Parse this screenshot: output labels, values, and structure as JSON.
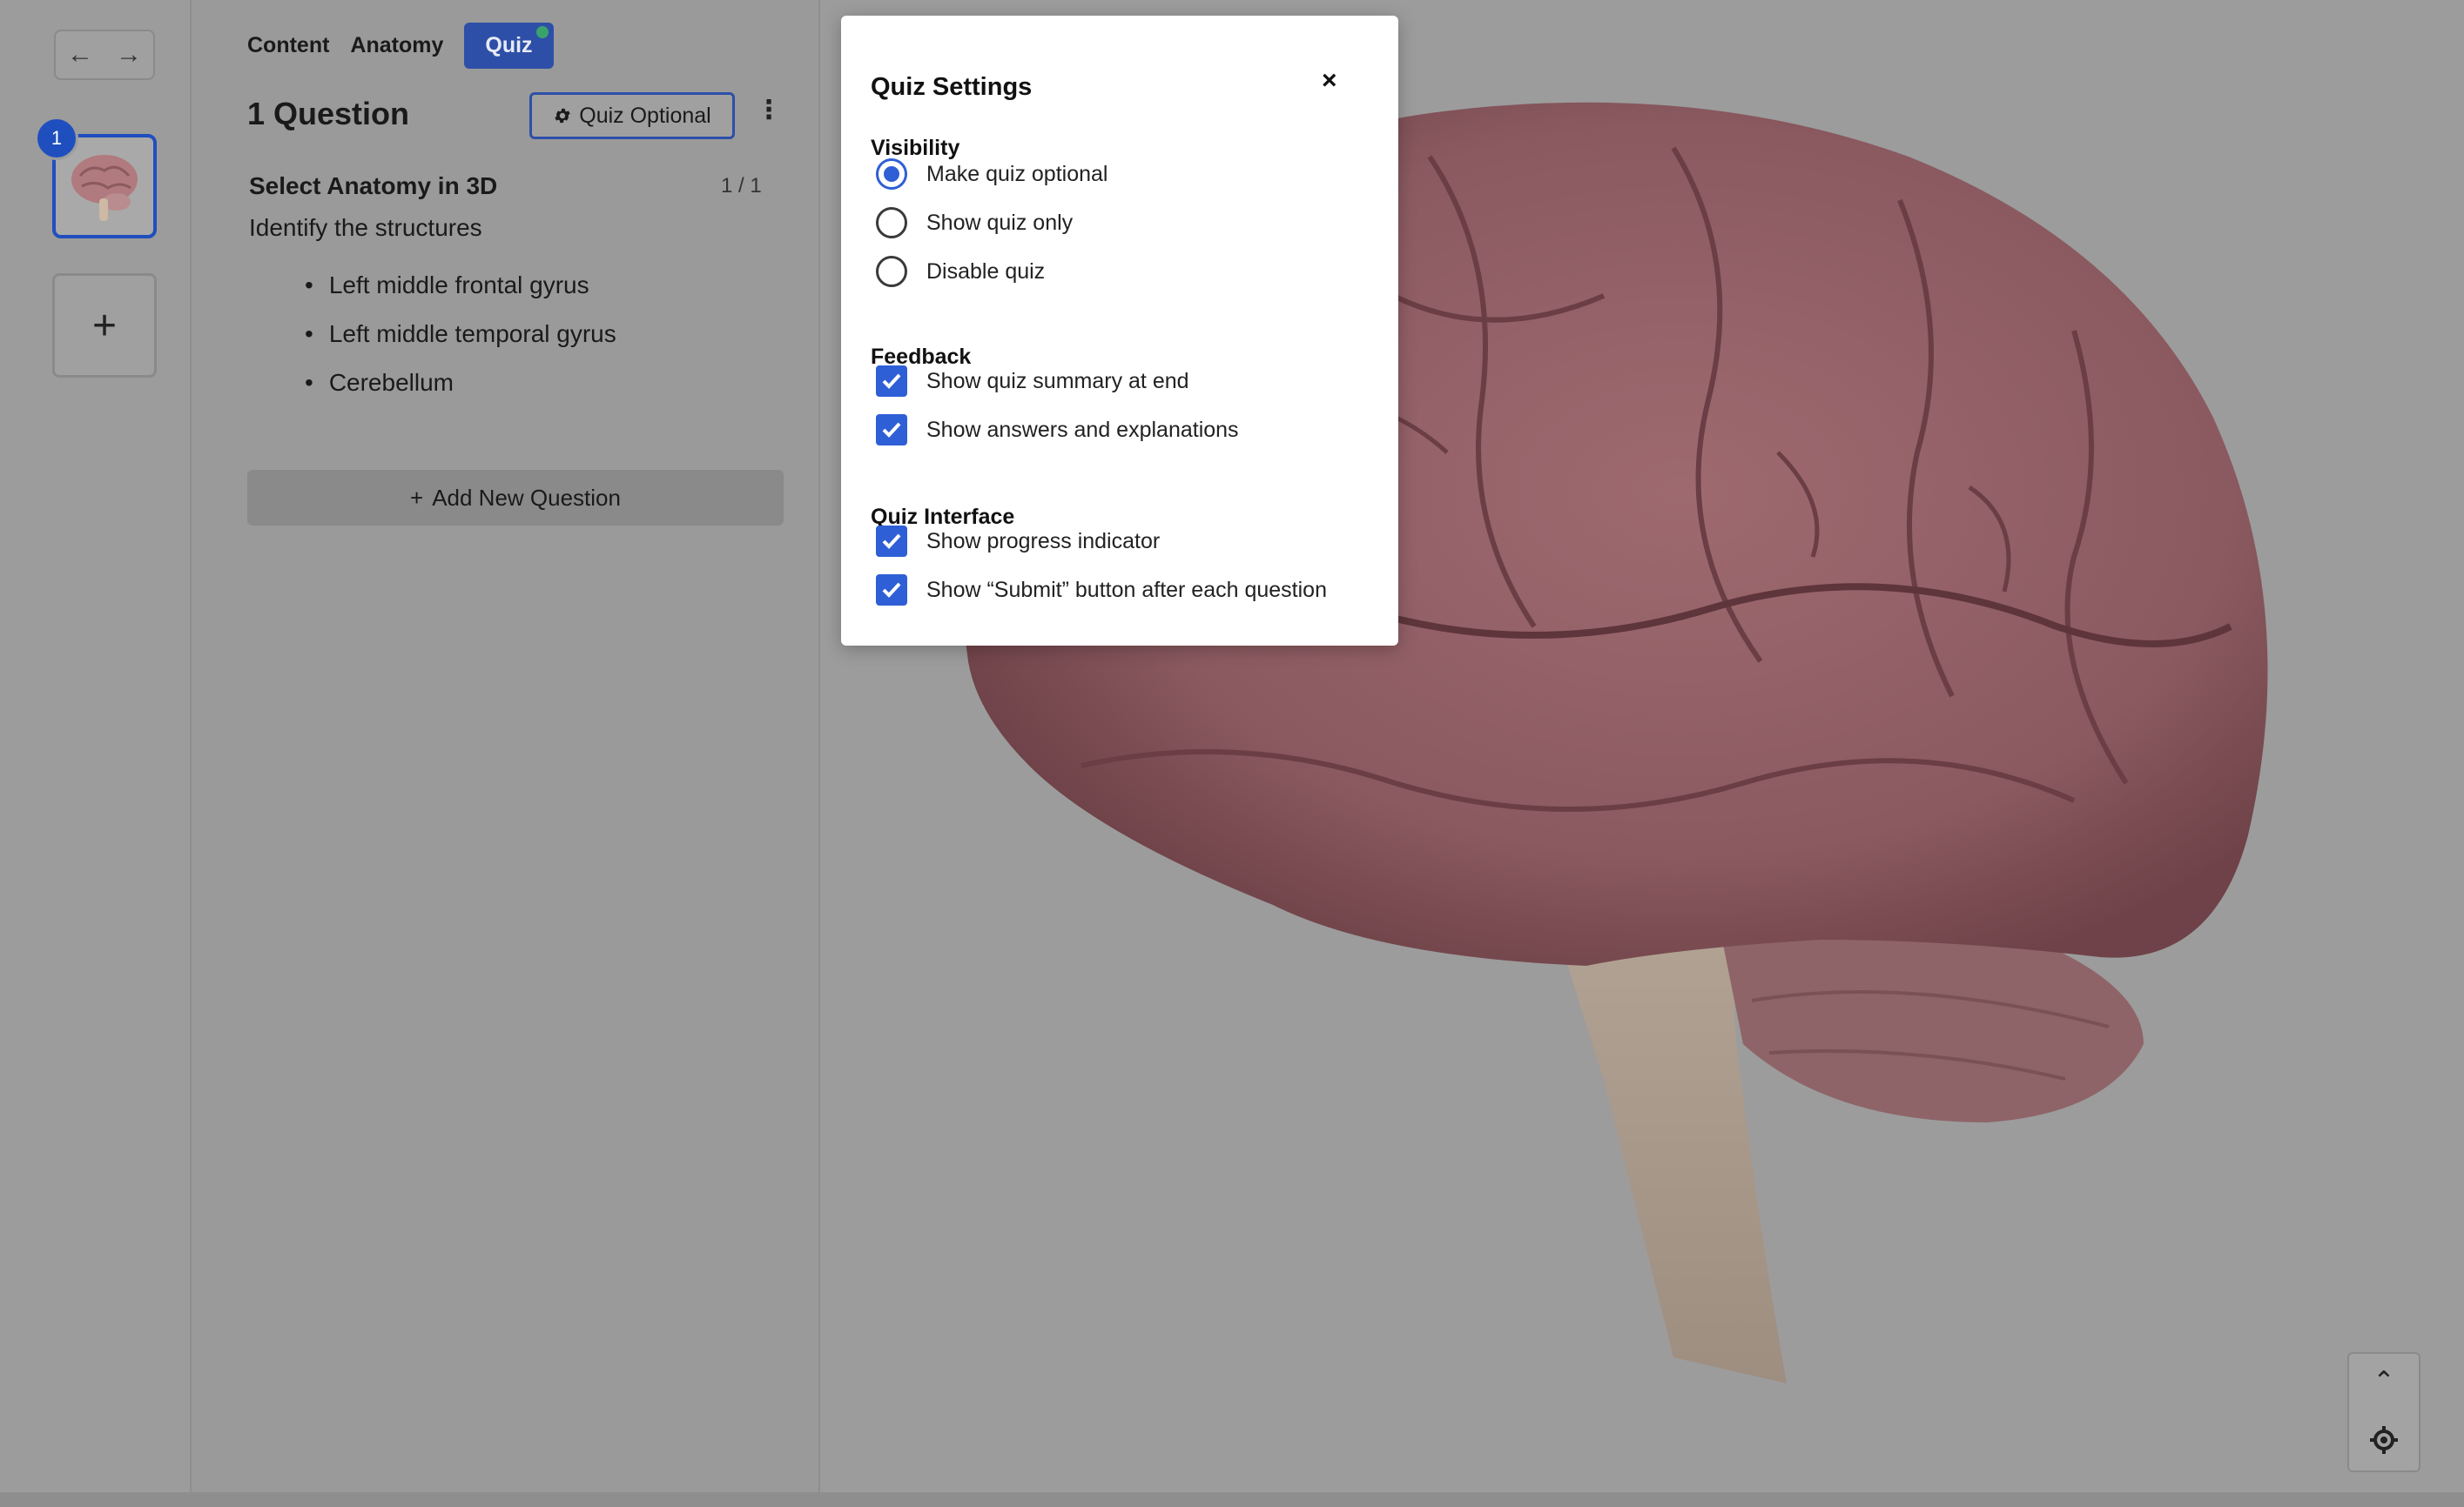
{
  "rail": {
    "back_arrow": "←",
    "forward_arrow": "→",
    "slide_number": "1",
    "add_slide": "+"
  },
  "panel": {
    "tabs": [
      {
        "label": "Content"
      },
      {
        "label": "Anatomy"
      },
      {
        "label": "Quiz",
        "active": true
      }
    ],
    "question_count": "1 Question",
    "quiz_optional_button": "Quiz Optional",
    "more_icon": "⋮",
    "question": {
      "title": "Select Anatomy in 3D",
      "position": "1 / 1",
      "prompt": "Identify the structures",
      "structures": [
        "Left middle frontal gyrus",
        "Left middle temporal gyrus",
        "Cerebellum"
      ]
    },
    "add_question": "Add New Question",
    "add_icon": "+"
  },
  "viewer": {
    "up_icon": "⌃",
    "locate_icon": "target-icon"
  },
  "modal": {
    "title": "Quiz Settings",
    "close": "×",
    "visibility": {
      "heading": "Visibility",
      "options": [
        {
          "label": "Make quiz optional",
          "selected": true
        },
        {
          "label": "Show quiz only",
          "selected": false
        },
        {
          "label": "Disable quiz",
          "selected": false
        }
      ]
    },
    "feedback": {
      "heading": "Feedback",
      "options": [
        {
          "label": "Show quiz summary at end",
          "checked": true
        },
        {
          "label": "Show answers and explanations",
          "checked": true
        }
      ]
    },
    "interface": {
      "heading": "Quiz Interface",
      "options": [
        {
          "label": "Show progress indicator",
          "checked": true
        },
        {
          "label": "Show “Submit” button after each question",
          "checked": true
        }
      ]
    }
  },
  "colors": {
    "accent": "#2e5fd6",
    "tab_active": "#2e4fa8",
    "overlay_gray": "#9c9c9c",
    "status_dot": "#39a36b"
  }
}
